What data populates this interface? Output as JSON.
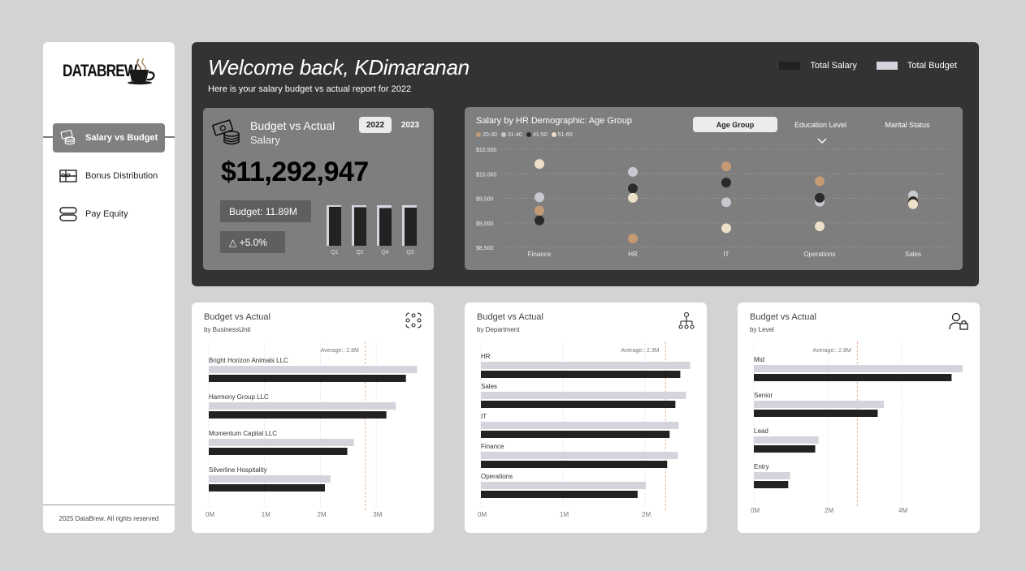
{
  "sidebar": {
    "logo_text": "DATABREW",
    "items": [
      {
        "label": "Salary vs Budget",
        "icon": "coins-icon",
        "active": true
      },
      {
        "label": "Bonus Distribution",
        "icon": "gift-card-icon",
        "active": false
      },
      {
        "label": "Pay Equity",
        "icon": "toggle-icon",
        "active": false
      }
    ],
    "footer": "2025 DataBrew. All rights reserved"
  },
  "header": {
    "welcome": "Welcome back, KDimaranan",
    "subtitle": "Here is your salary budget vs actual report for 2022",
    "legend": [
      {
        "label": "Total Salary",
        "color": "#222222"
      },
      {
        "label": "Total Budget",
        "color": "#d4d4dc"
      }
    ]
  },
  "colors": {
    "salary": "#222222",
    "budget": "#d4d4dc",
    "panel": "#333333",
    "card": "#7e7e7e",
    "average_line": "#e8b49a"
  },
  "kpi": {
    "title": "Budget vs Actual",
    "subtitle": "Salary",
    "years": [
      "2022",
      "2023"
    ],
    "selected_year": "2022",
    "value": "$11,292,947",
    "budget": "Budget: 11.89M",
    "change": "△ +5.0%",
    "mini_chart": {
      "categories": [
        "Q1",
        "Q2",
        "Q4",
        "Q3"
      ],
      "budget": [
        1.0,
        1.0,
        1.0,
        1.0
      ],
      "salary": [
        0.96,
        0.95,
        0.93,
        0.94
      ]
    }
  },
  "demographic": {
    "title": "Salary by HR Demographic: Age Group",
    "tabs": [
      "Age Group",
      "Education Level",
      "Marital Status"
    ],
    "selected_tab": "Age Group",
    "legend": [
      {
        "label": "20-30",
        "color": "#c49a74"
      },
      {
        "label": "31-40",
        "color": "#c8c8d0"
      },
      {
        "label": "41-50",
        "color": "#2a2a2a"
      },
      {
        "label": "51-60",
        "color": "#ede0c8"
      }
    ]
  },
  "chart_data": [
    {
      "type": "scatter",
      "title": "Salary by HR Demographic: Age Group",
      "categories": [
        "Finance",
        "HR",
        "IT",
        "Operations",
        "Sales"
      ],
      "yticks": [
        "$8,500",
        "$9,000",
        "$9,500",
        "$10,000",
        "$10,500"
      ],
      "ylim": [
        8500,
        10500
      ],
      "series": [
        {
          "name": "20-30",
          "values": [
            9250,
            8680,
            10150,
            9850,
            9500
          ]
        },
        {
          "name": "31-40",
          "values": [
            9520,
            10040,
            9420,
            9430,
            9560
          ]
        },
        {
          "name": "41-50",
          "values": [
            9050,
            9700,
            9820,
            9510,
            9440
          ]
        },
        {
          "name": "51-60",
          "values": [
            10200,
            9510,
            8890,
            8930,
            9380
          ]
        }
      ]
    },
    {
      "type": "bar",
      "title": "Budget vs Actual",
      "subtitle": "by BusinessUnit",
      "categories": [
        "Bright Horizon Animals LLC",
        "Harmony Group LLC",
        "Momentum Capital LLC",
        "Silverline Hospitality"
      ],
      "series": [
        {
          "name": "Total Budget",
          "values": [
            3.73,
            3.35,
            2.6,
            2.18
          ]
        },
        {
          "name": "Total Salary",
          "values": [
            3.53,
            3.18,
            2.48,
            2.08
          ]
        }
      ],
      "xticks": [
        "0M",
        "1M",
        "2M",
        "3M"
      ],
      "xlim": [
        0,
        4
      ],
      "average": 2.8,
      "average_label": "Average:: 2.8M"
    },
    {
      "type": "bar",
      "title": "Budget vs Actual",
      "subtitle": "by Department",
      "categories": [
        "HR",
        "Sales",
        "IT",
        "Finance",
        "Operations"
      ],
      "series": [
        {
          "name": "Total Budget",
          "values": [
            2.55,
            2.5,
            2.41,
            2.4,
            2.01
          ]
        },
        {
          "name": "Total Salary",
          "values": [
            2.43,
            2.37,
            2.3,
            2.27,
            1.91
          ]
        }
      ],
      "xticks": [
        "0M",
        "1M",
        "2M"
      ],
      "xlim": [
        0,
        3
      ],
      "average": 2.25,
      "average_label": "Average:: 2.3M"
    },
    {
      "type": "bar",
      "title": "Budget vs Actual",
      "subtitle": "by Level",
      "categories": [
        "Mid",
        "Senior",
        "Lead",
        "Entry"
      ],
      "series": [
        {
          "name": "Total Budget",
          "values": [
            5.65,
            3.52,
            1.75,
            0.98
          ]
        },
        {
          "name": "Total Salary",
          "values": [
            5.35,
            3.35,
            1.66,
            0.93
          ]
        }
      ],
      "xticks": [
        "0M",
        "2M",
        "4M"
      ],
      "xlim": [
        0,
        6
      ],
      "average": 2.8,
      "average_label": "Average:: 2.8M"
    }
  ],
  "cards": [
    {
      "title": "Budget vs Actual",
      "subtitle": "by BusinessUnit",
      "icon": "org-network-icon"
    },
    {
      "title": "Budget vs Actual",
      "subtitle": "by Department",
      "icon": "hierarchy-icon"
    },
    {
      "title": "Budget vs Actual",
      "subtitle": "by Level",
      "icon": "user-lock-icon"
    }
  ]
}
